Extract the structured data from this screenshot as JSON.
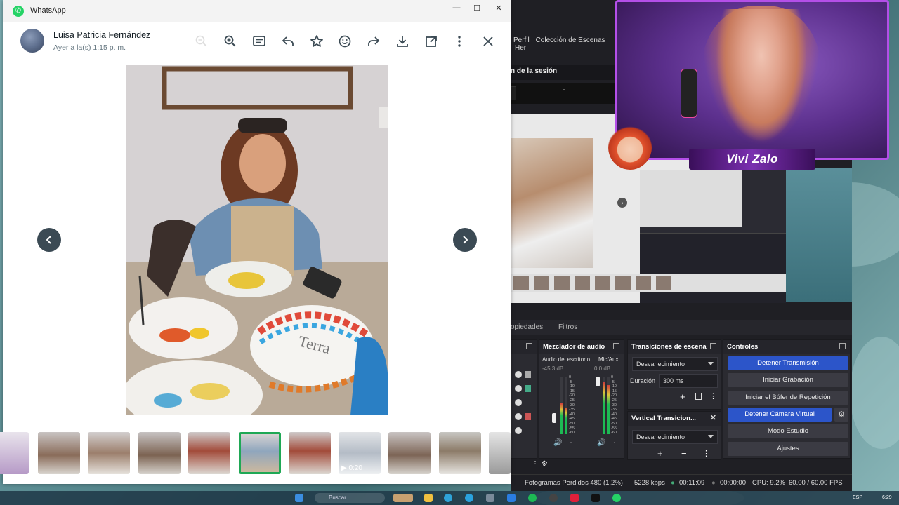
{
  "whatsapp": {
    "app_name": "WhatsApp",
    "contact_name": "Luisa Patricia Fernández",
    "timestamp": "Ayer a la(s) 1:15 p. m.",
    "video_duration": "0:20",
    "accent": "#25d366"
  },
  "obs": {
    "menu": [
      "Perfil",
      "Colección de Escenas",
      "Her"
    ],
    "session_label": "n de la sesión",
    "strip_dash": "-",
    "tabs": {
      "properties": "opiedades",
      "filters": "Filtros"
    },
    "mixer": {
      "title": "Mezclador de audio",
      "ch1_name": "Audio del escritorio",
      "ch1_db": "-45.3 dB",
      "ch2_name": "Mic/Aux",
      "ch2_db": "0.0 dB",
      "scale": [
        "0",
        "-5",
        "-10",
        "-15",
        "-20",
        "-25",
        "-30",
        "-35",
        "-40",
        "-45",
        "-50",
        "-55",
        "-60"
      ]
    },
    "transitions": {
      "title": "Transiciones de escena",
      "selected": "Desvanecimiento",
      "duration_label": "Duración",
      "duration_value": "300 ms"
    },
    "vertical": {
      "title": "Vertical Transicion...",
      "selected": "Desvanecimiento"
    },
    "controls": {
      "title": "Controles",
      "buttons": [
        "Detener Transmisión",
        "Iniciar Grabación",
        "Iniciar el Búfer de Repetición",
        "Detener Cámara Virtual",
        "Modo Estudio",
        "Ajustes"
      ]
    },
    "status": {
      "dropped": "Fotogramas Perdidos 480 (1.2%)",
      "bitrate": "5228 kbps",
      "stream_time": "00:11:09",
      "rec_time": "00:00:00",
      "cpu": "CPU: 9.2%",
      "fps": "60.00 / 60.00 FPS"
    },
    "accent": "#2c55c9"
  },
  "overlay": {
    "streamer_name": "Vivi Zalo"
  },
  "taskbar": {
    "search_placeholder": "Buscar",
    "language": "ESP",
    "clock": "6:29"
  }
}
